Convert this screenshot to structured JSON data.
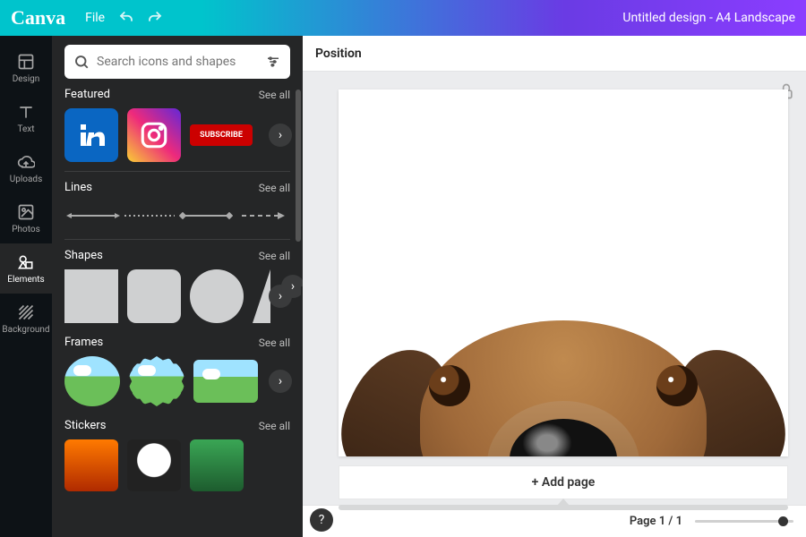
{
  "topbar": {
    "brand": "Canva",
    "file_label": "File",
    "doc_title": "Untitled design - A4 Landscape"
  },
  "rail": {
    "items": [
      {
        "id": "design",
        "label": "Design"
      },
      {
        "id": "text",
        "label": "Text"
      },
      {
        "id": "uploads",
        "label": "Uploads"
      },
      {
        "id": "photos",
        "label": "Photos"
      },
      {
        "id": "elements",
        "label": "Elements"
      },
      {
        "id": "background",
        "label": "Background"
      }
    ],
    "active": "elements"
  },
  "panel": {
    "search_placeholder": "Search icons and shapes",
    "sections": {
      "featured": {
        "title": "Featured",
        "see": "See all",
        "subscribe_label": "SUBSCRIBE"
      },
      "lines": {
        "title": "Lines",
        "see": "See all"
      },
      "shapes": {
        "title": "Shapes",
        "see": "See all"
      },
      "frames": {
        "title": "Frames",
        "see": "See all"
      },
      "stickers": {
        "title": "Stickers",
        "see": "See all"
      }
    }
  },
  "context_bar": {
    "position_label": "Position"
  },
  "canvas": {
    "add_page_label": "+ Add page"
  },
  "footer": {
    "page_count": "Page 1 / 1"
  }
}
